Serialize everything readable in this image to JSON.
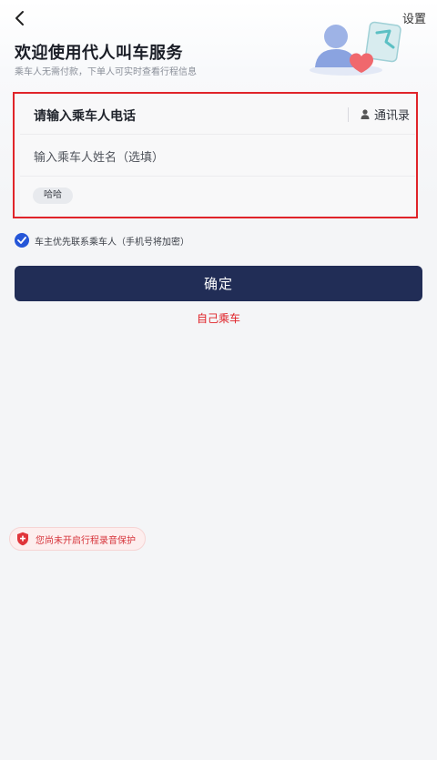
{
  "header": {
    "back_icon": "chevron-left-icon",
    "settings_label": "设置"
  },
  "intro": {
    "title": "欢迎使用代人叫车服务",
    "subtitle": "乘车人无需付款，下单人可实时查看行程信息"
  },
  "form": {
    "phone_label": "请输入乘车人电话",
    "contacts_label": "通讯录",
    "contacts_icon": "person-icon",
    "name_placeholder": "输入乘车人姓名（选填）",
    "history_chips": [
      "哈哈"
    ]
  },
  "consent": {
    "checked": true,
    "text": "车主优先联系乘车人（手机号将加密）"
  },
  "actions": {
    "confirm_label": "确定",
    "self_ride_label": "自己乘车"
  },
  "recording": {
    "icon": "shield-icon",
    "text": "您尚未开启行程录音保护"
  },
  "colors": {
    "primary_button": "#212d56",
    "accent_red": "#e0242a",
    "check_blue": "#2556d8"
  }
}
